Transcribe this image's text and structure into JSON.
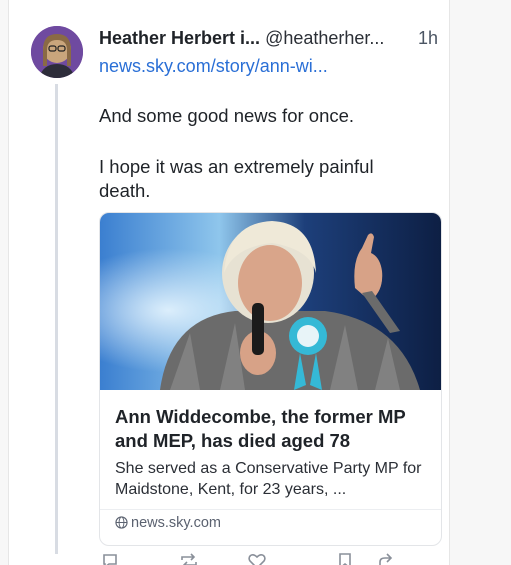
{
  "post": {
    "author_name": "Heather Herbert i...",
    "handle": "@heatherher...",
    "time": "1h",
    "link_text": "news.sky.com/story/ann-wi...",
    "body_lines": [
      "And some good news for once.",
      "I hope it was an extremely painful death."
    ]
  },
  "embed": {
    "title": "Ann Widdecombe, the former MP and MEP, has died aged 78",
    "description": "She served as a Conservative Party MP for Maidstone, Kent, for 23 years, ...",
    "domain": "news.sky.com",
    "domain_icon": "globe-icon",
    "image_subject": "photo-person-speaking-rosette"
  },
  "actions": [
    "reply-icon",
    "repost-icon",
    "like-icon",
    "bookmark-icon",
    "share-icon"
  ],
  "colors": {
    "link": "#2a6fd6",
    "text": "#1f2328",
    "muted": "#5b6270",
    "thread_line": "#d8dce3",
    "rosette": "#35b9d6"
  }
}
